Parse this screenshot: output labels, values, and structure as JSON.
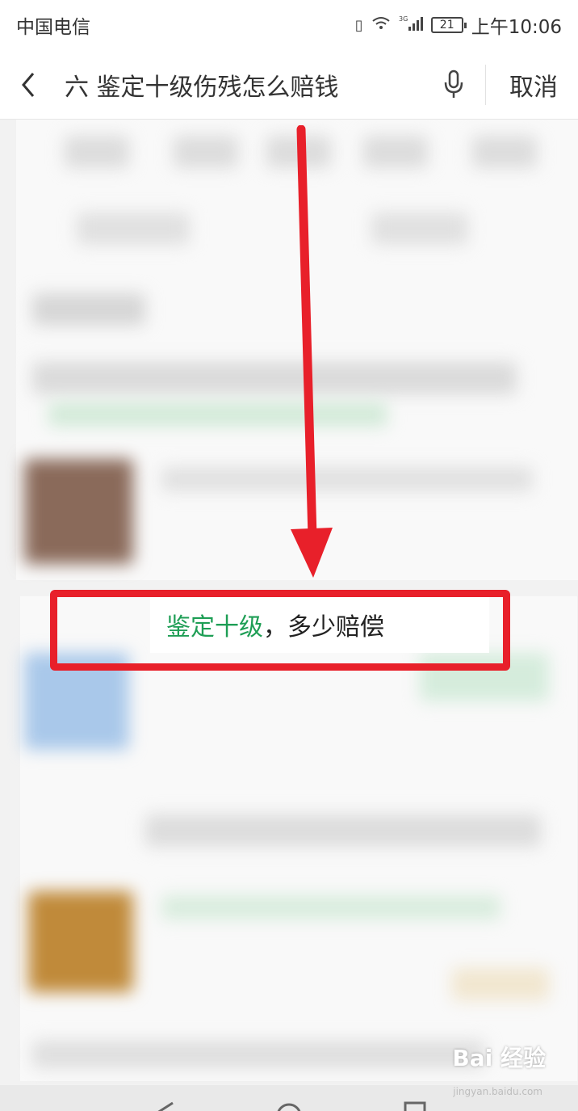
{
  "status_bar": {
    "carrier": "中国电信",
    "network": "3G",
    "battery": "21",
    "time": "上午10:06"
  },
  "search": {
    "query": "六 鉴定十级伤残怎么赔钱",
    "cancel_label": "取消"
  },
  "highlighted_result": {
    "highlight": "鉴定十级",
    "rest": "，多少赔偿"
  },
  "watermark": {
    "brand": "Bai 经验",
    "sub": "jingyan.baidu.com"
  },
  "colors": {
    "highlight": "#1e9e55",
    "annotation": "#e8202a"
  }
}
